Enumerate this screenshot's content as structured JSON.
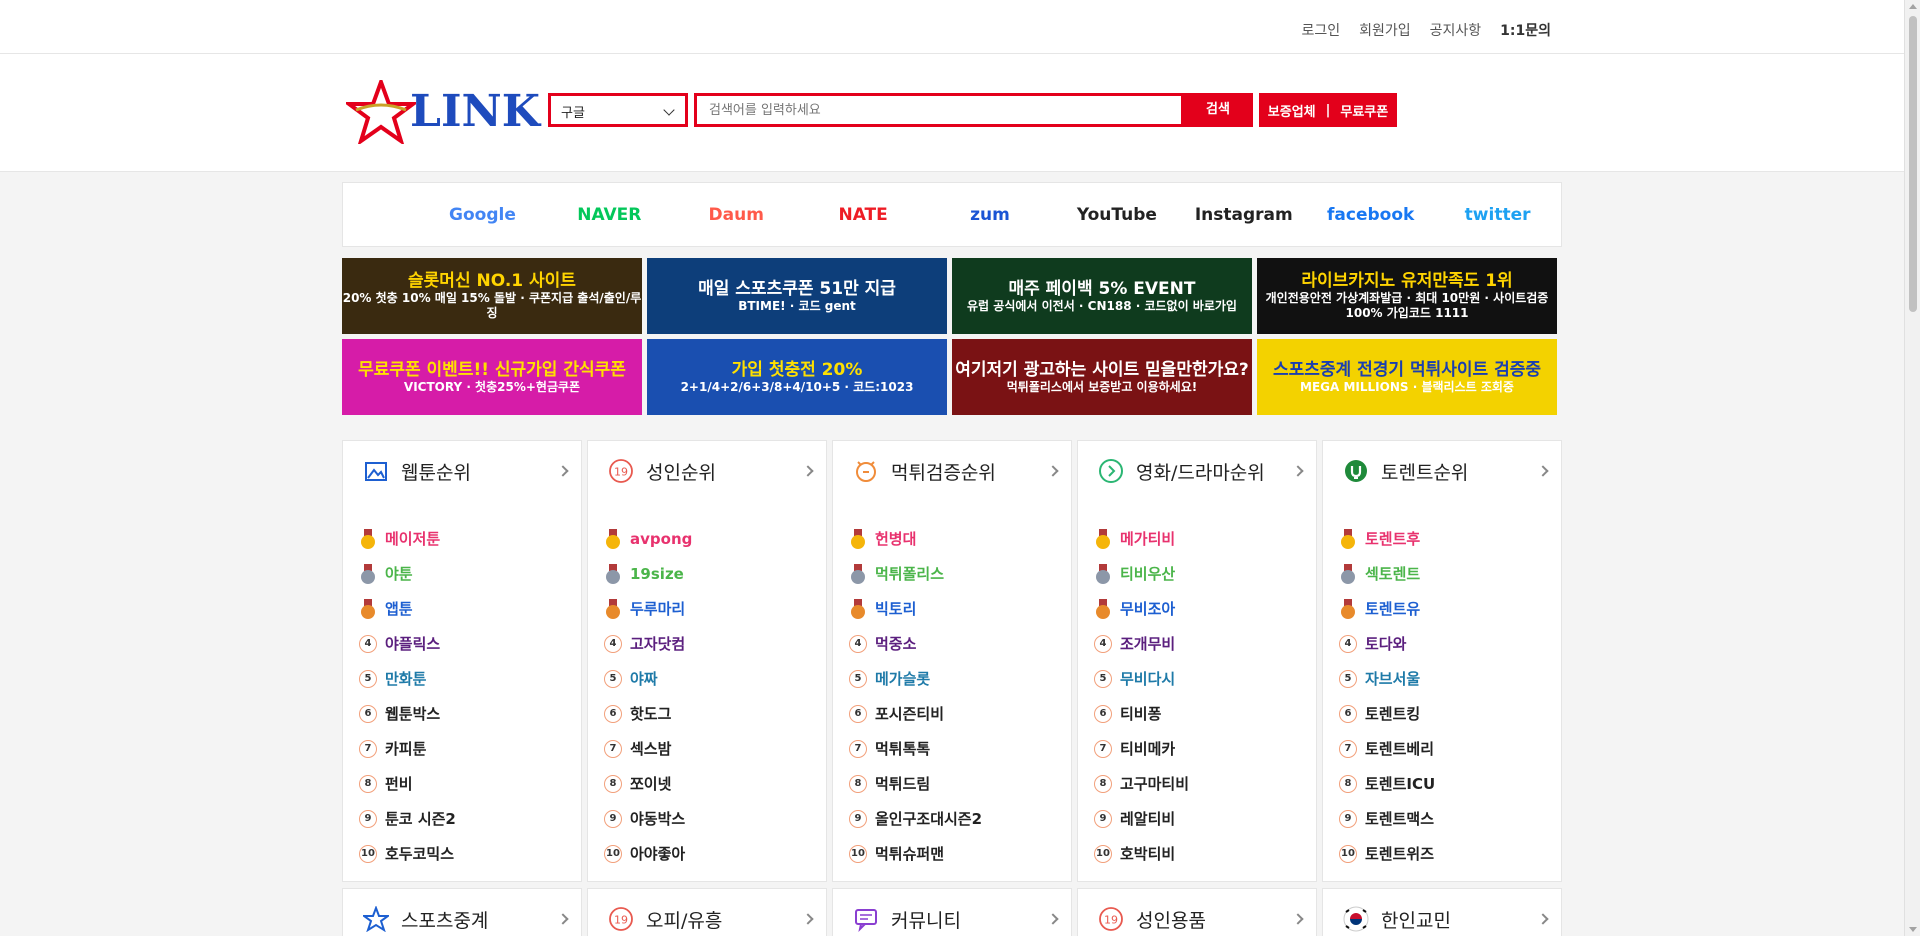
{
  "topnav": {
    "login": "로그인",
    "signup": "회원가입",
    "notice": "공지사항",
    "inquiry": "1:1문의"
  },
  "header": {
    "logo_text": "LINK",
    "engine_selected": "구글",
    "search_placeholder": "검색어를 입력하세요",
    "search_button": "검색",
    "guarantee_label": "보증업체",
    "separator": "|",
    "coupon_label": "무료쿠폰"
  },
  "portals": [
    {
      "label": "Google",
      "color": "#4285f4"
    },
    {
      "label": "NAVER",
      "color": "#03c75a"
    },
    {
      "label": "Daum",
      "color": "#ff5a4a"
    },
    {
      "label": "NATE",
      "color": "#ee1c25"
    },
    {
      "label": "zum",
      "color": "#1a54d4"
    },
    {
      "label": "YouTube",
      "color": "#222222"
    },
    {
      "label": "Instagram",
      "color": "#222222"
    },
    {
      "label": "facebook",
      "color": "#1877f2"
    },
    {
      "label": "twitter",
      "color": "#1da1f2"
    }
  ],
  "banners": [
    {
      "main": "슬롯머신 NO.1 사이트",
      "sub": "20% 첫충 10% 매일 15% 돌발 · 쿠폰지급 출석/출인/루징",
      "bg": "#3a2a10",
      "accent": "#ffd400"
    },
    {
      "main": "매일 스포츠쿠폰 51만 지급",
      "sub": "BTIME! · 코드 gent",
      "bg": "#0d3e7a",
      "accent": "#ffffff"
    },
    {
      "main": "매주 페이백 5% EVENT",
      "sub": "유럽 공식에서 이전서 · CN188 · 코드없이 바로가입",
      "bg": "#0f3b1e",
      "accent": "#ffffff"
    },
    {
      "main": "라이브카지노 유저만족도 1위",
      "sub": "개인전용안전 가상계좌발급 · 최대 10만원 · 사이트검증 100% 가입코드 1111",
      "bg": "#111111",
      "accent": "#ffd400"
    },
    {
      "main": "무료쿠폰 이벤트!! 신규가입 간식쿠폰",
      "sub": "VICTORY · 첫충25%+현금쿠폰",
      "bg": "#d61ca8",
      "accent": "#ffe000"
    },
    {
      "main": "가입 첫충전 20%",
      "sub": "2+1/4+2/6+3/8+4/10+5 · 코드:1023",
      "bg": "#1a4fb0",
      "accent": "#ffe000"
    },
    {
      "main": "여기저기 광고하는 사이트 믿을만한가요?",
      "sub": "먹튀폴리스에서 보증받고 이용하세요!",
      "bg": "#7a1214",
      "accent": "#ffffff"
    },
    {
      "main": "스포츠중계 전경기 먹튀사이트 검증중",
      "sub": "MEGA MILLIONS · 블랙리스트 조회중",
      "bg": "#f3d200",
      "accent": "#1a3fb0"
    }
  ],
  "cards": [
    {
      "title": "웹툰순위",
      "icon": "image-icon",
      "icon_color": "#1d5fd1",
      "items": [
        {
          "label": "메이저툰",
          "color": "#e8326e"
        },
        {
          "label": "야툰",
          "color": "#4bb54a"
        },
        {
          "label": "앱툰",
          "color": "#1d5fd1"
        },
        {
          "label": "야플릭스",
          "color": "#5b1f7e"
        },
        {
          "label": "만화툰",
          "color": "#1e7aa8"
        },
        {
          "label": "웹툰박스",
          "color": "#222222"
        },
        {
          "label": "카피툰",
          "color": "#222222"
        },
        {
          "label": "펀비",
          "color": "#222222"
        },
        {
          "label": "툰코 시즌2",
          "color": "#222222"
        },
        {
          "label": "호두코믹스",
          "color": "#222222"
        }
      ]
    },
    {
      "title": "성인순위",
      "icon": "adult-19-icon",
      "icon_color": "#e8594f",
      "items": [
        {
          "label": "avpong",
          "color": "#e8326e"
        },
        {
          "label": "19size",
          "color": "#4bb54a"
        },
        {
          "label": "두루마리",
          "color": "#1d5fd1"
        },
        {
          "label": "고자닷컴",
          "color": "#5b1f7e"
        },
        {
          "label": "야짜",
          "color": "#1e7aa8"
        },
        {
          "label": "핫도그",
          "color": "#222222"
        },
        {
          "label": "섹스밤",
          "color": "#222222"
        },
        {
          "label": "쪼이넷",
          "color": "#222222"
        },
        {
          "label": "야동박스",
          "color": "#222222"
        },
        {
          "label": "아야좋아",
          "color": "#222222"
        }
      ]
    },
    {
      "title": "먹튀검증순위",
      "icon": "alarm-icon",
      "icon_color": "#f08c3a",
      "items": [
        {
          "label": "헌병대",
          "color": "#e8326e"
        },
        {
          "label": "먹튀폴리스",
          "color": "#4bb54a"
        },
        {
          "label": "빅토리",
          "color": "#1d5fd1"
        },
        {
          "label": "먹중소",
          "color": "#5b1f7e"
        },
        {
          "label": "메가슬롯",
          "color": "#1e7aa8"
        },
        {
          "label": "포시즌티비",
          "color": "#222222"
        },
        {
          "label": "먹튀톡톡",
          "color": "#222222"
        },
        {
          "label": "먹튀드림",
          "color": "#222222"
        },
        {
          "label": "올인구조대시즌2",
          "color": "#222222"
        },
        {
          "label": "먹튀슈퍼맨",
          "color": "#222222"
        }
      ]
    },
    {
      "title": "영화/드라마순위",
      "icon": "play-circle-icon",
      "icon_color": "#2bb673",
      "items": [
        {
          "label": "메가티비",
          "color": "#e8326e"
        },
        {
          "label": "티비우산",
          "color": "#4bb54a"
        },
        {
          "label": "무비조아",
          "color": "#1d5fd1"
        },
        {
          "label": "조개무비",
          "color": "#5b1f7e"
        },
        {
          "label": "무비다시",
          "color": "#1e7aa8"
        },
        {
          "label": "티비퐁",
          "color": "#222222"
        },
        {
          "label": "티비메카",
          "color": "#222222"
        },
        {
          "label": "고구마티비",
          "color": "#222222"
        },
        {
          "label": "레알티비",
          "color": "#222222"
        },
        {
          "label": "호박티비",
          "color": "#222222"
        }
      ]
    },
    {
      "title": "토렌트순위",
      "icon": "torrent-icon",
      "icon_color": "#1f8a3a",
      "items": [
        {
          "label": "토렌트후",
          "color": "#e8326e"
        },
        {
          "label": "섹토렌트",
          "color": "#4bb54a"
        },
        {
          "label": "토렌트유",
          "color": "#1d5fd1"
        },
        {
          "label": "토다와",
          "color": "#5b1f7e"
        },
        {
          "label": "자브서울",
          "color": "#1e7aa8"
        },
        {
          "label": "토렌트킹",
          "color": "#222222"
        },
        {
          "label": "토렌트베리",
          "color": "#222222"
        },
        {
          "label": "토렌트ICU",
          "color": "#222222"
        },
        {
          "label": "토렌트맥스",
          "color": "#222222"
        },
        {
          "label": "토렌트위즈",
          "color": "#222222"
        }
      ]
    }
  ],
  "cards_row2": [
    {
      "title": "스포츠중계",
      "icon": "star-icon",
      "icon_color": "#1d5fd1"
    },
    {
      "title": "오피/유흥",
      "icon": "adult-19-icon",
      "icon_color": "#e8594f"
    },
    {
      "title": "커뮤니티",
      "icon": "chat-icon",
      "icon_color": "#8a3fd1"
    },
    {
      "title": "성인용품",
      "icon": "adult-19-icon",
      "icon_color": "#e8594f"
    },
    {
      "title": "한인교민",
      "icon": "korea-flag-icon",
      "icon_color": "#c8102e"
    }
  ],
  "rank_numbers": [
    "1",
    "2",
    "3",
    "4",
    "5",
    "6",
    "7",
    "8",
    "9",
    "10"
  ],
  "medal_colors": [
    "#f5b50a",
    "#8c97a8",
    "#e88a2b"
  ]
}
